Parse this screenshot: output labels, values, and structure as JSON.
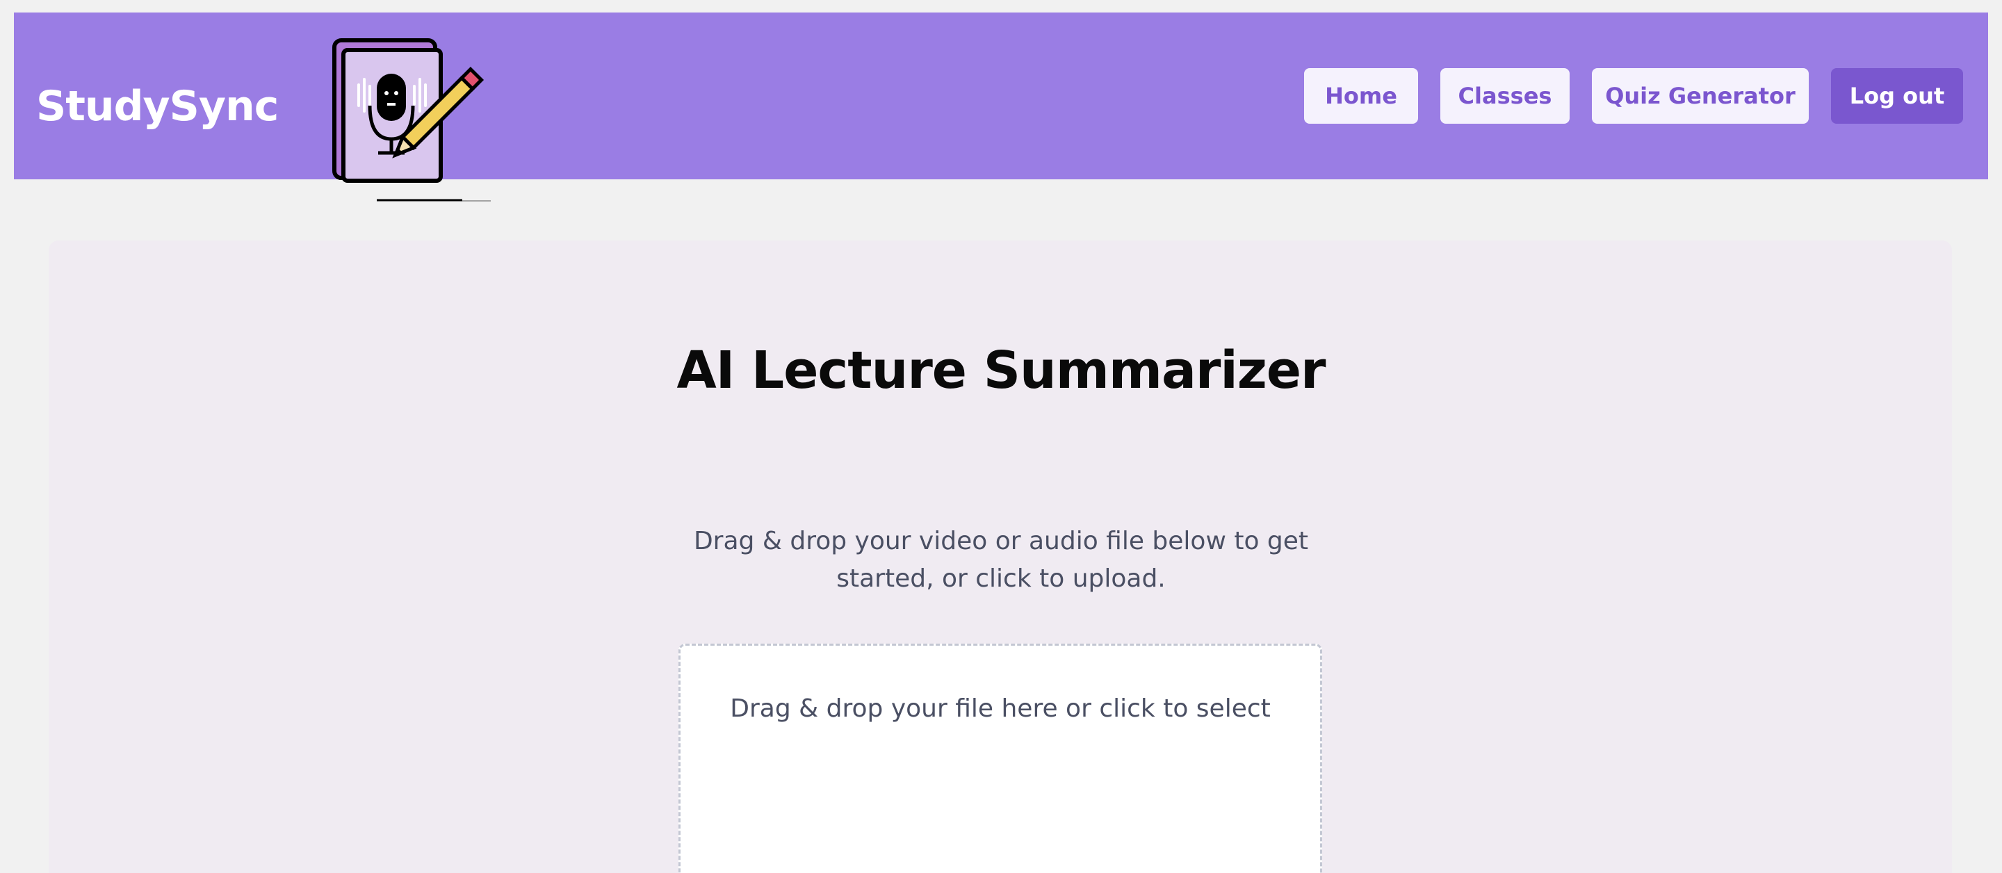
{
  "header": {
    "brand": "StudySync",
    "nav": {
      "home": "Home",
      "classes": "Classes",
      "quiz": "Quiz Generator",
      "logout": "Log out"
    }
  },
  "logo": {
    "icon": "notebook-microphone-pencil-icon"
  },
  "main": {
    "title": "AI Lecture Summarizer",
    "subtitle": "Drag & drop your video or audio file below to get started, or click to upload.",
    "dropzone": {
      "text": "Drag & drop your file here or click to select"
    }
  },
  "colors": {
    "header_bg": "#9a7de4",
    "accent": "#7a57cf",
    "page_bg": "#f1f1f1",
    "card_bg": "#f0ebf2"
  }
}
